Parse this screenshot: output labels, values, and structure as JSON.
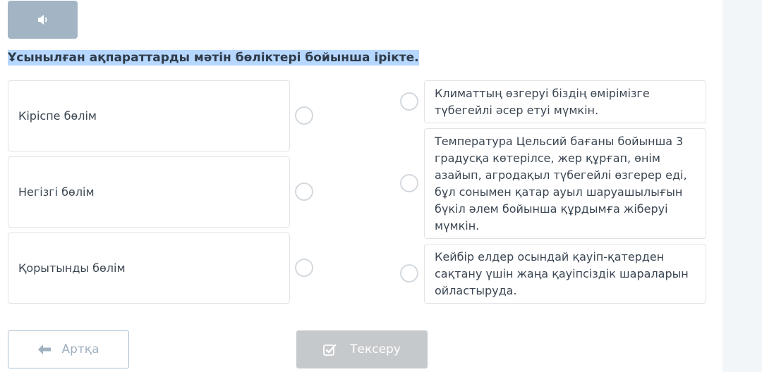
{
  "audio": {
    "icon": "speaker-icon"
  },
  "question": "Ұсынылған ақпараттарды мәтін бөліктері бойынша іріктe.",
  "left_items": [
    {
      "label": "Кіріспе бөлім"
    },
    {
      "label": "Негізгі бөлім"
    },
    {
      "label": "Қорытынды бөлім"
    }
  ],
  "right_items": [
    {
      "text": "Климаттың өзгеруі біздің өмірімізге түбегейлі әсер етуі мүмкін."
    },
    {
      "text": "Температура Цельсий бағаны бойынша 3 градусқа көтерілсе, жер құрғап, өнім азайып, агродақыл түбегейлі өзгерер еді, бұл сонымен қатар ауыл шаруашылығын бүкіл әлем бойынша құрдымға жіберуі мүмкін."
    },
    {
      "text": "Кейбір елдер осындай қауіп-қатерден сақтану үшін жаңа қауіпсіздік шараларын ойластыруда."
    }
  ],
  "buttons": {
    "back_label": "Артқа",
    "check_label": "Тексеру"
  },
  "colors": {
    "highlight": "#b6d7ff",
    "disabled_button": "#c6c9cc",
    "audio_button": "#a3b5c4"
  }
}
